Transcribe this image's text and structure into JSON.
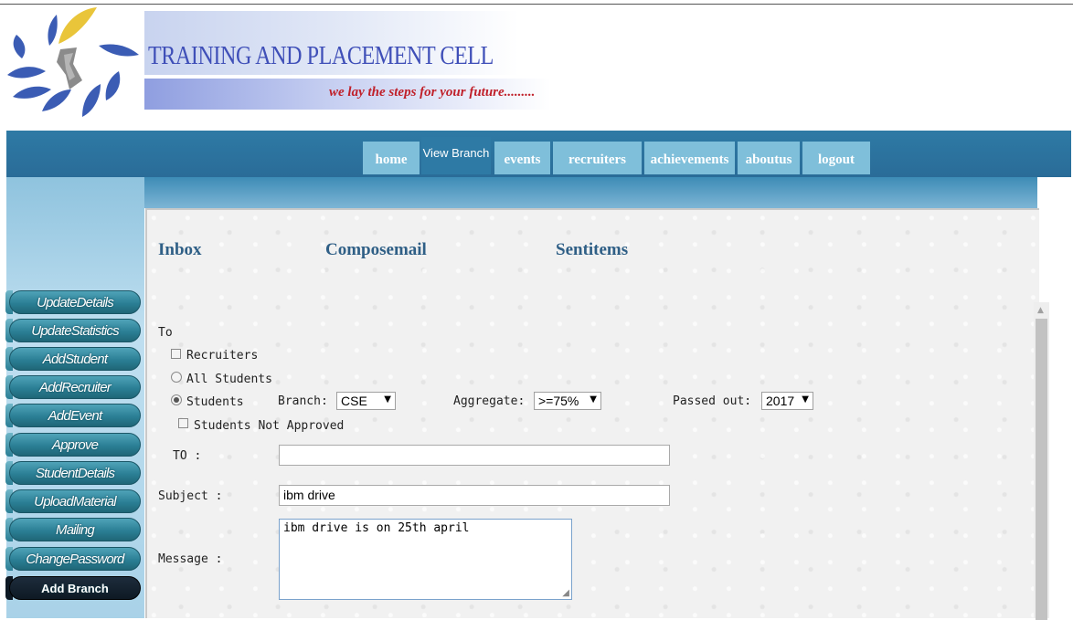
{
  "header": {
    "title": "TRAINING AND PLACEMENT CELL",
    "tagline": "we lay the steps for your future.........",
    "logo_colors": [
      "#3b5cb4",
      "#e9c53a",
      "#8b8b8b"
    ]
  },
  "nav": {
    "tabs": [
      {
        "label": "home",
        "active": false
      },
      {
        "label": "View Branch",
        "active": true
      },
      {
        "label": "events",
        "active": false
      },
      {
        "label": "recruiters",
        "active": false
      },
      {
        "label": "achievements",
        "active": false
      },
      {
        "label": "aboutus",
        "active": false
      },
      {
        "label": "logout",
        "active": false
      }
    ]
  },
  "sidebar": {
    "items": [
      {
        "label": "UpdateDetails"
      },
      {
        "label": "UpdateStatistics"
      },
      {
        "label": "AddStudent"
      },
      {
        "label": "AddRecruiter"
      },
      {
        "label": "AddEvent"
      },
      {
        "label": "Approve"
      },
      {
        "label": "StudentDetails"
      },
      {
        "label": "UploadMaterial"
      },
      {
        "label": "Mailing"
      },
      {
        "label": "ChangePassword"
      },
      {
        "label": "Add Branch"
      }
    ]
  },
  "mail": {
    "tabs": [
      "Inbox",
      "Composemail",
      "Sentitems"
    ]
  },
  "form": {
    "to_heading": "To",
    "recruiters_label": "Recruiters",
    "recruiters_checked": false,
    "all_students_label": "All Students",
    "students_label": "Students",
    "selected_recipient": "Students",
    "branch_label": "Branch:",
    "branch_value": "CSE",
    "aggregate_label": "Aggregate:",
    "aggregate_value": ">=75%",
    "passed_out_label": "Passed out:",
    "passed_out_value": "2017",
    "not_approved_label": "Students Not Approved",
    "not_approved_checked": false,
    "to_field_label": "TO :",
    "to_field_value": "",
    "subject_label": "Subject :",
    "subject_value": "ibm drive",
    "message_label": "Message :",
    "message_value": "ibm drive is on 25th april"
  },
  "colors": {
    "navbar": "#2a6c98",
    "nav_tab": "#7fbfda",
    "sidebar_button": "#2b7f95",
    "mail_tab_text": "#2f5f86",
    "tagline": "#c0202a",
    "title": "#3f4fb8"
  },
  "icons": {
    "scroll_up": "chevron-up-icon",
    "select_arrow": "caret-down-icon",
    "resize": "resize-grip-icon"
  }
}
